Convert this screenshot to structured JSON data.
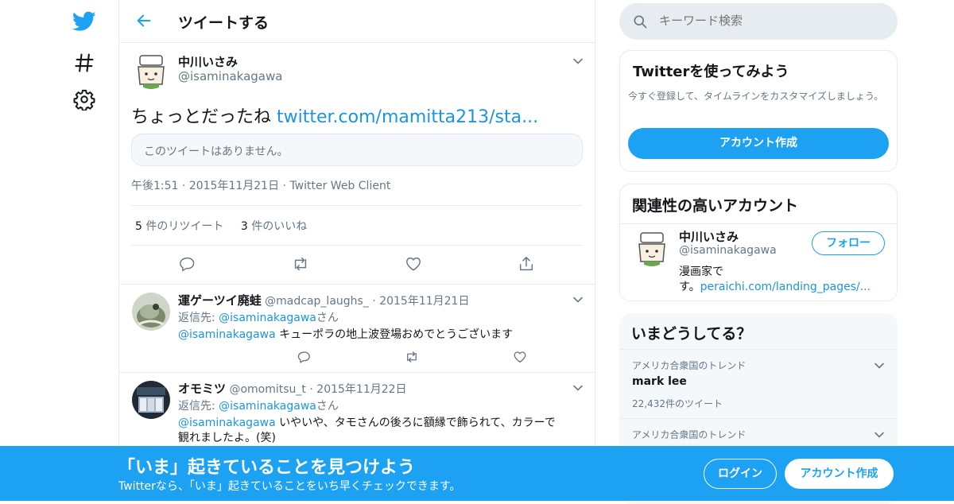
{
  "colors": {
    "brand": "#1da1f2",
    "link": "#1b95e0",
    "muted": "#657786",
    "border": "#e6ecf0"
  },
  "nav": {
    "icons": [
      "twitter-bird-icon",
      "hashtag-icon",
      "gear-icon"
    ]
  },
  "header": {
    "title": "ツイートする"
  },
  "tweet": {
    "name": "中川いさみ",
    "handle": "@isaminakagawa",
    "text": "ちょっとだったね",
    "link": "twitter.com/mamitta213/sta...",
    "quote_unavailable": "このツイートはありません。",
    "time": "午後1:51",
    "date": "2015年11月21日",
    "client": "Twitter Web Client",
    "retweet_count": "5",
    "retweet_label": "件のリツイート",
    "like_count": "3",
    "like_label": "件のいいね"
  },
  "replies": [
    {
      "name": "運ゲーツイ廃蛙",
      "handle": "@madcap_laughs_",
      "date": "2015年11月21日",
      "reply_to_label": "返信先:",
      "reply_to": "@isaminakagawa",
      "reply_to_suffix": "さん",
      "mention": "@isaminakagawa",
      "text": "キューポラの地上波登場おめでとうございます"
    },
    {
      "name": "オモミツ",
      "handle": "@omomitsu_t",
      "date": "2015年11月22日",
      "reply_to_label": "返信先:",
      "reply_to": "@isaminakagawa",
      "reply_to_suffix": "さん",
      "mention": "@isaminakagawa",
      "text": "いやいや、タモさんの後ろに額縁で飾られて、カラーで",
      "text2": "観れましたよ。(笑)"
    }
  ],
  "sidebar": {
    "search_placeholder": "キーワード検索",
    "try": {
      "title": "Twitterを使ってみよう",
      "desc": "今すぐ登録して、タイムラインをカスタマイズしましょう。",
      "button": "アカウント作成"
    },
    "related": {
      "title": "関連性の高いアカウント",
      "name": "中川いさみ",
      "handle": "@isaminakagawa",
      "bio1": "漫画家で",
      "bio2_prefix": "す。",
      "bio2_link": "peraichi.com/landing_pages/...",
      "follow": "フォロー"
    },
    "trends": {
      "title": "いまどうしてる？",
      "items": [
        {
          "context": "アメリカ合衆国のトレンド",
          "name": "mark lee",
          "count": "22,432件のツイート"
        },
        {
          "context": "アメリカ合衆国のトレンド"
        }
      ]
    }
  },
  "banner": {
    "title": "「いま」起きていることを見つけよう",
    "subtitle": "Twitterなら、「いま」起きていることをいち早くチェックできます。",
    "login": "ログイン",
    "signup": "アカウント作成"
  }
}
